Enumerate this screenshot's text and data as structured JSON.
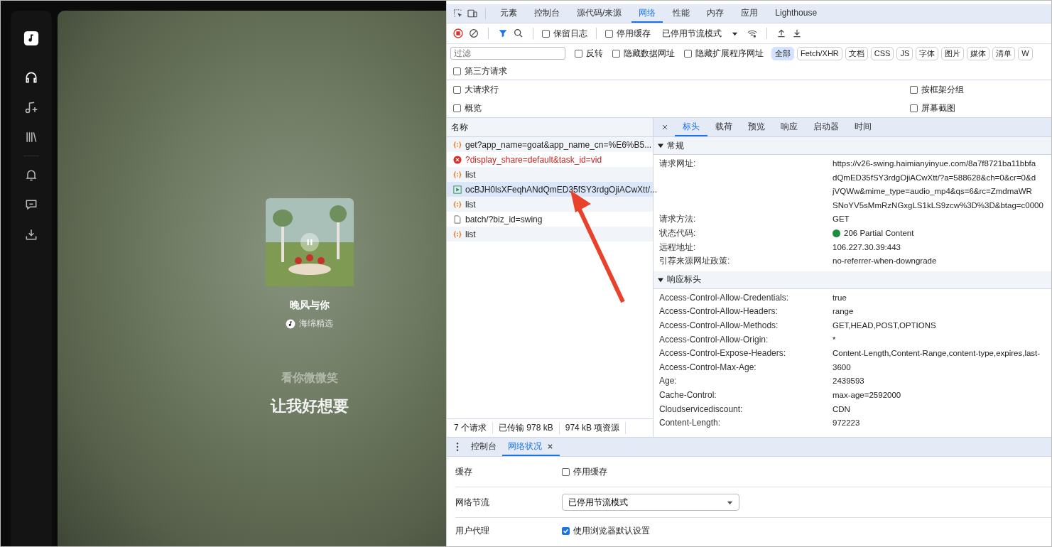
{
  "player": {
    "playing": true,
    "song": {
      "title": "晚风与你",
      "artist": "海绵精选"
    },
    "lyrics": [
      {
        "text": "看你微微笑",
        "current": false
      },
      {
        "text": "让我好想要",
        "current": true
      }
    ]
  },
  "devtools": {
    "panel_tabs": [
      {
        "label": "元素",
        "selected": false
      },
      {
        "label": "控制台",
        "selected": false
      },
      {
        "label": "源代码/来源",
        "selected": false
      },
      {
        "label": "网络",
        "selected": true
      },
      {
        "label": "性能",
        "selected": false
      },
      {
        "label": "内存",
        "selected": false
      },
      {
        "label": "应用",
        "selected": false
      },
      {
        "label": "Lighthouse",
        "selected": false
      }
    ],
    "toolbar": {
      "recording": true,
      "preserve_log": {
        "label": "保留日志",
        "checked": false
      },
      "disable_cache": {
        "label": "停用缓存",
        "checked": false
      },
      "throttling": "已停用节流模式"
    },
    "filter": {
      "placeholder": "过滤",
      "options": [
        {
          "label": "反转",
          "checked": false
        },
        {
          "label": "隐藏数据网址",
          "checked": false
        },
        {
          "label": "隐藏扩展程序网址",
          "checked": false
        }
      ],
      "types": [
        {
          "label": "全部",
          "selected": true
        },
        {
          "label": "Fetch/XHR",
          "selected": false
        },
        {
          "label": "文档",
          "selected": false
        },
        {
          "label": "CSS",
          "selected": false
        },
        {
          "label": "JS",
          "selected": false
        },
        {
          "label": "字体",
          "selected": false
        },
        {
          "label": "图片",
          "selected": false
        },
        {
          "label": "媒体",
          "selected": false
        },
        {
          "label": "清单",
          "selected": false
        },
        {
          "label": "W",
          "selected": false
        }
      ]
    },
    "third_party": {
      "label": "第三方请求",
      "checked": false
    },
    "settings_left": [
      {
        "label": "大请求行",
        "checked": false
      },
      {
        "label": "概览",
        "checked": false
      }
    ],
    "settings_right": [
      {
        "label": "按框架分组",
        "checked": false
      },
      {
        "label": "屏幕截图",
        "checked": false
      }
    ],
    "requests": {
      "column": "名称",
      "rows": [
        {
          "name": "get?app_name=goat&app_name_cn=%E6%B5...",
          "kind": "fetch",
          "selected": false
        },
        {
          "name": "?display_share=default&task_id=vid",
          "kind": "error",
          "selected": false
        },
        {
          "name": "list",
          "kind": "fetch",
          "selected": false
        },
        {
          "name": "ocBJH0lsXFeqhANdQmED35fSY3rdgOjiACwXtt/...",
          "kind": "media",
          "selected": true
        },
        {
          "name": "list",
          "kind": "fetch",
          "selected": false
        },
        {
          "name": "batch/?biz_id=swing",
          "kind": "document",
          "selected": false
        },
        {
          "name": "list",
          "kind": "fetch",
          "selected": false
        }
      ],
      "summary": [
        "7 个请求",
        "已传输 978 kB",
        "974 kB 项资源"
      ]
    },
    "detail": {
      "tabs": [
        {
          "label": "标头",
          "selected": true
        },
        {
          "label": "载荷",
          "selected": false
        },
        {
          "label": "预览",
          "selected": false
        },
        {
          "label": "响应",
          "selected": false
        },
        {
          "label": "启动器",
          "selected": false
        },
        {
          "label": "时间",
          "selected": false
        }
      ],
      "sections": [
        {
          "title": "常规",
          "expanded": true,
          "rows": [
            {
              "key": "请求网址:",
              "lines": [
                "https://v26-swing.haimianyinyue.com/8a7f8721ba11bbfa",
                "dQmED35fSY3rdgOjiACwXtt/?a=588628&ch=0&cr=0&d",
                "jVQWw&mime_type=audio_mp4&qs=6&rc=ZmdmaWR",
                "SNoYV5sMmRzNGxgLS1kLS9zcw%3D%3D&btag=c0000"
              ]
            },
            {
              "key": "请求方法:",
              "lines": [
                "GET"
              ]
            },
            {
              "key": "状态代码:",
              "lines": [
                "206 Partial Content"
              ],
              "color": "#1e8e3e"
            },
            {
              "key": "远程地址:",
              "lines": [
                "106.227.30.39:443"
              ]
            },
            {
              "key": "引荐来源网址政策:",
              "lines": [
                "no-referrer-when-downgrade"
              ]
            }
          ]
        },
        {
          "title": "响应标头",
          "expanded": true,
          "rows": [
            {
              "key": "Access-Control-Allow-Credentials:",
              "lines": [
                "true"
              ]
            },
            {
              "key": "Access-Control-Allow-Headers:",
              "lines": [
                "range"
              ]
            },
            {
              "key": "Access-Control-Allow-Methods:",
              "lines": [
                "GET,HEAD,POST,OPTIONS"
              ]
            },
            {
              "key": "Access-Control-Allow-Origin:",
              "lines": [
                "*"
              ]
            },
            {
              "key": "Access-Control-Expose-Headers:",
              "lines": [
                "Content-Length,Content-Range,content-type,expires,last-"
              ]
            },
            {
              "key": "Access-Control-Max-Age:",
              "lines": [
                "3600"
              ]
            },
            {
              "key": "Age:",
              "lines": [
                "2439593"
              ]
            },
            {
              "key": "Cache-Control:",
              "lines": [
                "max-age=2592000"
              ]
            },
            {
              "key": "Cloudservicediscount:",
              "lines": [
                "CDN"
              ]
            },
            {
              "key": "Content-Length:",
              "lines": [
                "972223"
              ]
            }
          ]
        }
      ]
    },
    "drawer": {
      "tabs": [
        {
          "label": "控制台",
          "selected": false,
          "closable": false
        },
        {
          "label": "网络状况",
          "selected": true,
          "closable": true
        }
      ],
      "settings": [
        {
          "kind": "checkbox",
          "label": "缓存",
          "option": "停用缓存",
          "checked": false
        },
        {
          "kind": "select",
          "label": "网络节流",
          "value": "已停用节流模式"
        },
        {
          "kind": "checkbox",
          "label": "用户代理",
          "option": "使用浏览器默认设置",
          "checked": true
        }
      ]
    }
  }
}
